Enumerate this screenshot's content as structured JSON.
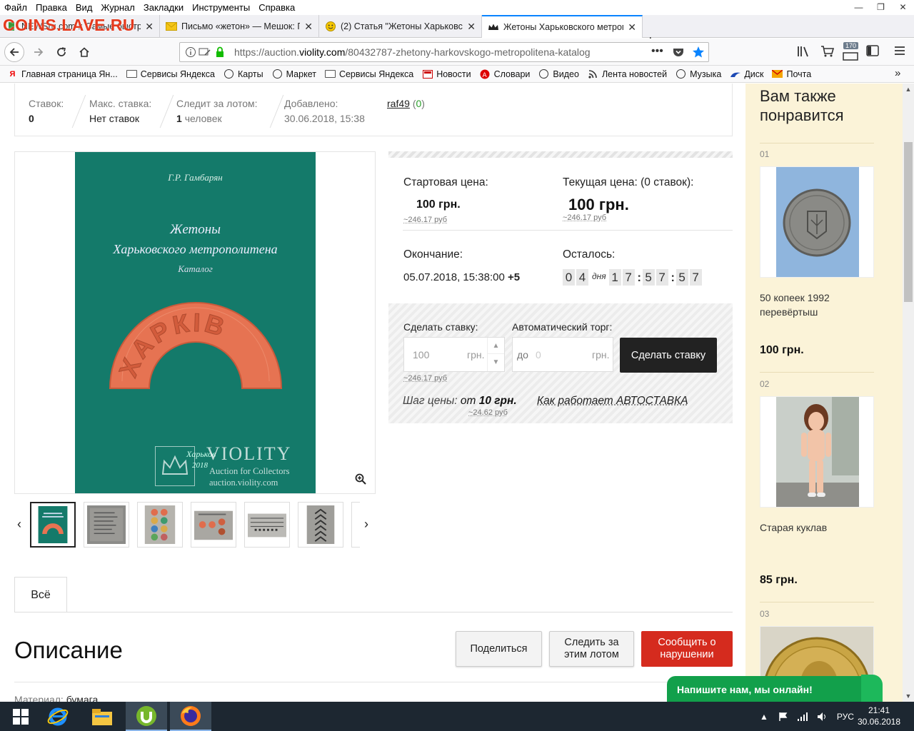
{
  "watermark": "COINS.LAVE.RU",
  "menu": [
    "Файл",
    "Правка",
    "Вид",
    "Журнал",
    "Закладки",
    "Инструменты",
    "Справка"
  ],
  "window_controls": [
    "—",
    "❐",
    "✕"
  ],
  "tabs": [
    {
      "title": "NEWSru.com :: Самые быстр",
      "favicon": "newsru-icon"
    },
    {
      "title": "Письмо «жетон» — Мешок: П",
      "favicon": "mail-envelope-icon"
    },
    {
      "title": "(2) Статья \"Жетоны Харьковск",
      "favicon": "smiley-icon"
    },
    {
      "title": "Жетоны Харьковского метропо",
      "favicon": "violity-crown-icon",
      "active": true
    }
  ],
  "url": {
    "protocol": "https://auction.",
    "host": "violity.com",
    "path": "/80432787-zhetony-harkovskogo-metropolitena-katalog"
  },
  "toolbar_badge": "170",
  "bookmarks": [
    {
      "label": "Главная страница Ян...",
      "icon": "yandex-icon"
    },
    {
      "label": "Сервисы Яндекса",
      "icon": "folder-icon"
    },
    {
      "label": "Карты",
      "icon": "globe-icon"
    },
    {
      "label": "Маркет",
      "icon": "globe-icon"
    },
    {
      "label": "Сервисы Яндекса",
      "icon": "folder-icon"
    },
    {
      "label": "Новости",
      "icon": "news-icon"
    },
    {
      "label": "Словари",
      "icon": "dictionary-icon"
    },
    {
      "label": "Видео",
      "icon": "globe-icon"
    },
    {
      "label": "Лента новостей",
      "icon": "rss-icon"
    },
    {
      "label": "Музыка",
      "icon": "globe-icon"
    },
    {
      "label": "Диск",
      "icon": "disk-icon"
    },
    {
      "label": "Почта",
      "icon": "mail-icon"
    }
  ],
  "stats": {
    "bids_label": "Ставок:",
    "bids_value": "0",
    "max_label": "Макс. ставка:",
    "max_value": "Нет ставок",
    "watch_label": "Следит за лотом:",
    "watch_count": "1",
    "watch_unit": "человек",
    "added_label": "Добавлено:",
    "added_value": "30.06.2018, 15:38",
    "seller": "raf49",
    "seller_open": "(",
    "seller_rating": "0",
    "seller_close": ")"
  },
  "book": {
    "author": "Г.Р. Гамбарян",
    "title_line1": "Жетоны",
    "title_line2": "Харьковского метрополитена",
    "title_line3": "Каталог",
    "token_text": "ХАРКІВ",
    "city": "Харьков",
    "year": "2018"
  },
  "image_watermark": {
    "brand": "VIOLITY",
    "slogan": "Auction for Collectors",
    "site": "auction.violity.com"
  },
  "thumbnails": [
    {
      "icon": "book-cover-thumb",
      "selected": true
    },
    {
      "icon": "text-page-thumb"
    },
    {
      "icon": "token-column-thumb"
    },
    {
      "icon": "token-row-thumb"
    },
    {
      "icon": "table-page-thumb"
    },
    {
      "icon": "chevron-page-thumb"
    }
  ],
  "price": {
    "start_label": "Стартовая цена:",
    "start_value": "100 грн.",
    "start_rub": "~246.17 руб",
    "current_label": "Текущая цена: (0 ставок):",
    "current_value": "100 грн.",
    "current_rub": "~246.17 руб",
    "end_label": "Окончание:",
    "end_value": "05.07.2018, 15:38:00",
    "end_tz": "+5",
    "left_label": "Осталось:",
    "days": [
      "0",
      "4"
    ],
    "days_word": "дня",
    "hours": [
      "1",
      "7"
    ],
    "minutes": [
      "5",
      "7"
    ],
    "seconds": [
      "5",
      "7"
    ],
    "colon": ":"
  },
  "bid_form": {
    "bid_label": "Сделать ставку:",
    "bid_placeholder": "100",
    "currency": "грн.",
    "bid_rub": "~246.17 руб",
    "auto_label": "Автоматический торг:",
    "auto_prefix": "до",
    "auto_placeholder": "0",
    "submit": "Сделать ставку",
    "step_label": "Шаг цены:",
    "step_from": "от",
    "step_value": "10 грн.",
    "step_rub": "~24.62 руб",
    "auto_link": "Как работает АВТОСТАВКА"
  },
  "tabs_section": {
    "all": "Всё"
  },
  "description": {
    "title": "Описание",
    "share": "Поделиться",
    "watch": "Следить за этим лотом",
    "report": "Сообщить о нарушении",
    "material_label": "Материал:",
    "material_value": "бумага"
  },
  "sidebar": {
    "title": "Вам также понравится",
    "items": [
      {
        "num": "01",
        "name": "50 копеек 1992 перевёртыш",
        "price": "100 грн.",
        "icon": "coin-50-kopeek-image"
      },
      {
        "num": "02",
        "name": "Старая куклав",
        "price": "85 грн.",
        "icon": "doll-image"
      },
      {
        "num": "03",
        "icon": "gold-coin-image"
      }
    ]
  },
  "chat": "Напишите нам, мы онлайн!",
  "tray": {
    "lang": "РУС",
    "time": "21:41",
    "date": "30.06.2018"
  }
}
